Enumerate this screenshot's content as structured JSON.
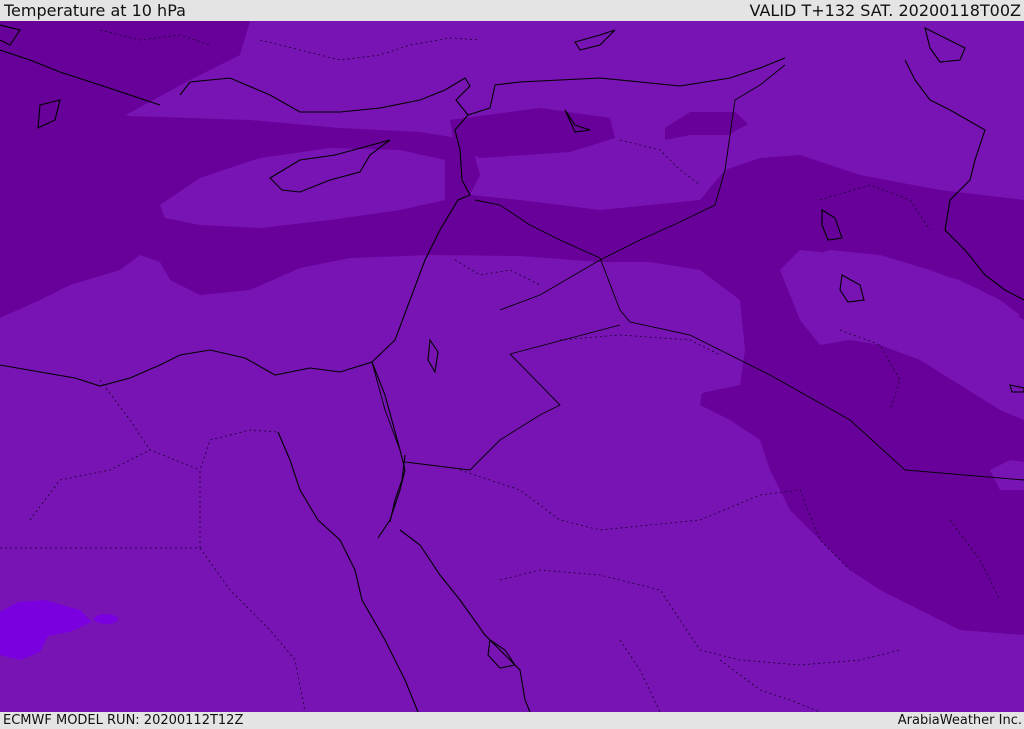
{
  "header": {
    "title": "Temperature at 10 hPa",
    "valid": "VALID T+132 SAT. 20200118T00Z"
  },
  "footer": {
    "model_run": "ECMWF MODEL RUN: 20200112T12Z",
    "credit": "ArabiaWeather Inc."
  },
  "map": {
    "parameter": "Temperature",
    "level": "10 hPa",
    "colors": {
      "base": "#7814b4",
      "colder_band": "#68009a",
      "warm_patch": "#7b00e0",
      "lines": "#000000",
      "header_background": "#e4e4e4"
    }
  }
}
